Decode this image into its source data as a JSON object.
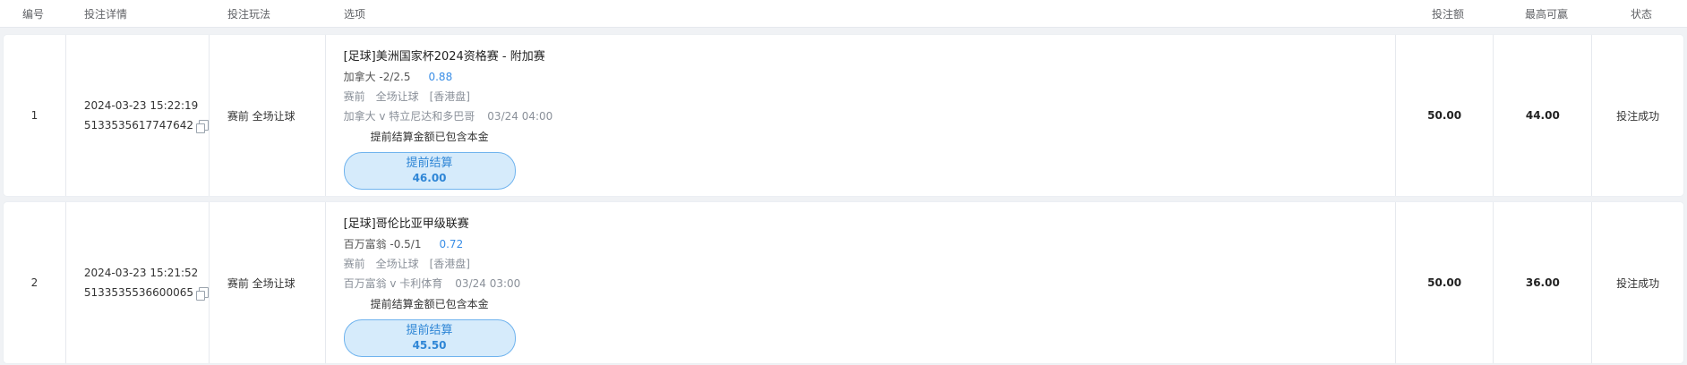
{
  "header": {
    "no": "编号",
    "detail": "投注详情",
    "play": "投注玩法",
    "option": "选项",
    "amount": "投注额",
    "max_win": "最高可赢",
    "status": "状态"
  },
  "rows": [
    {
      "no": "1",
      "time": "2024-03-23 15:22:19",
      "order_id": "5133535617747642",
      "play": "赛前 全场让球",
      "league": "[足球]美洲国家杯2024资格赛 - 附加赛",
      "pick": "加拿大 -2/2.5",
      "odds": "0.88",
      "stage": "赛前",
      "market": "全场让球",
      "odds_type": "[香港盘]",
      "match": "加拿大 v 特立尼达和多巴哥",
      "match_time": "03/24 04:00",
      "note": "提前结算金额已包含本金",
      "cashout_label": "提前结算",
      "cashout_value": "46.00",
      "amount": "50.00",
      "max_win": "44.00",
      "status": "投注成功"
    },
    {
      "no": "2",
      "time": "2024-03-23 15:21:52",
      "order_id": "5133535536600065",
      "play": "赛前 全场让球",
      "league": "[足球]哥伦比亚甲级联赛",
      "pick": "百万富翁 -0.5/1",
      "odds": "0.72",
      "stage": "赛前",
      "market": "全场让球",
      "odds_type": "[香港盘]",
      "match": "百万富翁 v 卡利体育",
      "match_time": "03/24 03:00",
      "note": "提前结算金额已包含本金",
      "cashout_label": "提前结算",
      "cashout_value": "45.50",
      "amount": "50.00",
      "max_win": "36.00",
      "status": "投注成功"
    }
  ],
  "colors": {
    "accent": "#3a8ee6",
    "button_bg": "#d6ebfb",
    "button_border": "#6fb3ee",
    "page_bg": "#f0f2f5"
  },
  "icons": {
    "copy": "copy-icon"
  }
}
